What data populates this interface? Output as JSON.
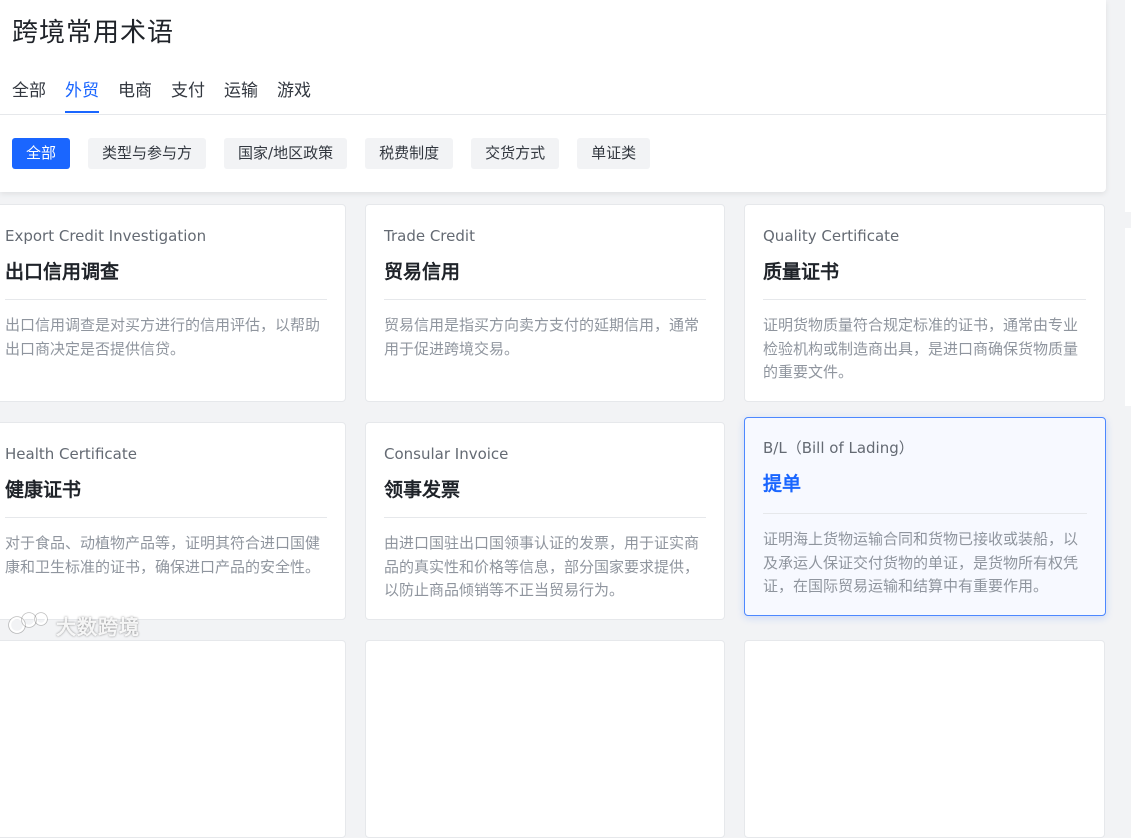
{
  "header": {
    "title": "跨境常用术语",
    "tabs": [
      {
        "label": "全部",
        "active": false
      },
      {
        "label": "外贸",
        "active": true
      },
      {
        "label": "电商",
        "active": false
      },
      {
        "label": "支付",
        "active": false
      },
      {
        "label": "运输",
        "active": false
      },
      {
        "label": "游戏",
        "active": false
      }
    ],
    "filters": [
      {
        "label": "全部",
        "active": true
      },
      {
        "label": "类型与参与方",
        "active": false
      },
      {
        "label": "国家/地区政策",
        "active": false
      },
      {
        "label": "税费制度",
        "active": false
      },
      {
        "label": "交货方式",
        "active": false
      },
      {
        "label": "单证类",
        "active": false
      }
    ]
  },
  "cards": [
    {
      "en": "Export Credit Investigation",
      "zh": "出口信用调查",
      "desc": "出口信用调查是对买方进行的信用评估，以帮助出口商决定是否提供信贷。"
    },
    {
      "en": "Trade Credit",
      "zh": "贸易信用",
      "desc": "贸易信用是指买方向卖方支付的延期信用，通常用于促进跨境交易。"
    },
    {
      "en": "Quality Certificate",
      "zh": "质量证书",
      "desc": "证明货物质量符合规定标准的证书，通常由专业检验机构或制造商出具，是进口商确保货物质量的重要文件。"
    },
    {
      "en": "Health Certificate",
      "zh": "健康证书",
      "desc": "对于食品、动植物产品等，证明其符合进口国健康和卫生标准的证书，确保进口产品的安全性。"
    },
    {
      "en": "Consular Invoice",
      "zh": "领事发票",
      "desc": "由进口国驻出口国领事认证的发票，用于证实商品的真实性和价格等信息，部分国家要求提供，以防止商品倾销等不正当贸易行为。"
    },
    {
      "en": "B/L（Bill of Lading）",
      "zh": "提单",
      "desc": "证明海上货物运输合同和货物已接收或装船，以及承运人保证交付货物的单证，是货物所有权凭证，在国际贸易运输和结算中有重要作用。",
      "highlighted": true
    }
  ],
  "watermark": {
    "text": "大数跨境",
    "icon": "brand-logo-icon"
  },
  "colors": {
    "accent": "#1a66ff",
    "background": "#f2f3f5",
    "chip_bg": "#f2f3f5",
    "desc_text": "#8f959e"
  }
}
